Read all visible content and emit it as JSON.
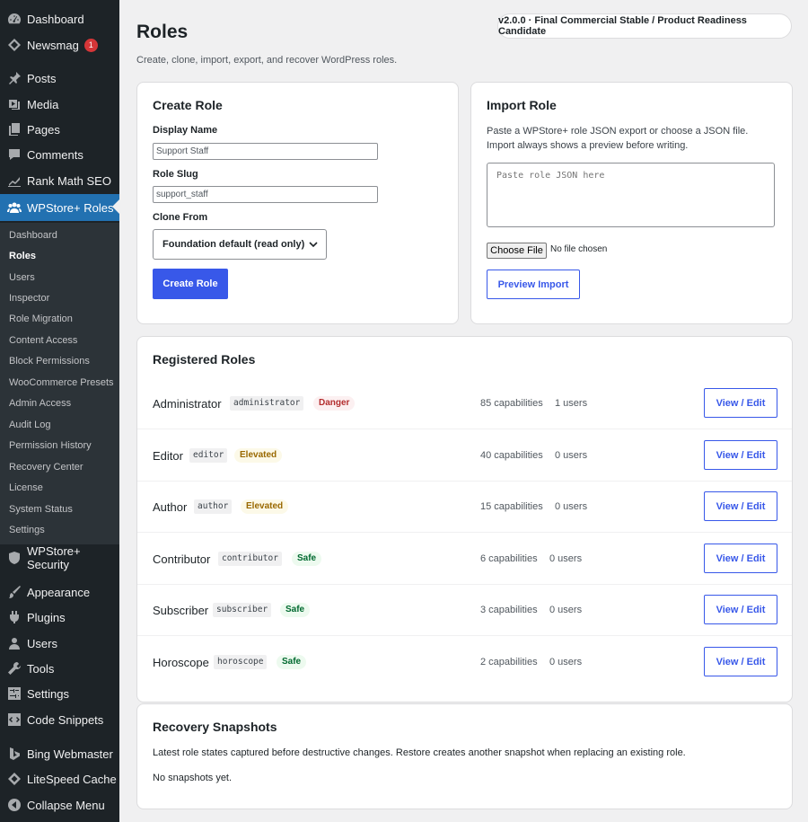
{
  "sidebar": {
    "top_items": [
      {
        "label": "Dashboard",
        "icon": "dashboard-icon"
      },
      {
        "label": "Newsmag",
        "icon": "newsmag-icon",
        "badge": "1"
      }
    ],
    "content_items": [
      {
        "label": "Posts",
        "icon": "pin-icon"
      },
      {
        "label": "Media",
        "icon": "media-icon"
      },
      {
        "label": "Pages",
        "icon": "pages-icon"
      },
      {
        "label": "Comments",
        "icon": "comments-icon"
      },
      {
        "label": "Rank Math SEO",
        "icon": "chart-icon"
      },
      {
        "label": "WPStore+ Roles",
        "icon": "users-group-icon"
      }
    ],
    "submenu": [
      "Dashboard",
      "Roles",
      "Users",
      "Inspector",
      "Role Migration",
      "Content Access",
      "Block Permissions",
      "WooCommerce Presets",
      "Admin Access",
      "Audit Log",
      "Permission History",
      "Recovery Center",
      "License",
      "System Status",
      "Settings"
    ],
    "submenu_current": "Roles",
    "security_item": {
      "label": "WPStore+ Security",
      "icon": "shield-icon"
    },
    "bottom_items": [
      {
        "label": "Appearance",
        "icon": "brush-icon"
      },
      {
        "label": "Plugins",
        "icon": "plugin-icon"
      },
      {
        "label": "Users",
        "icon": "user-icon"
      },
      {
        "label": "Tools",
        "icon": "wrench-icon"
      },
      {
        "label": "Settings",
        "icon": "settings-icon"
      },
      {
        "label": "Code Snippets",
        "icon": "code-icon"
      }
    ],
    "extra_items": [
      {
        "label": "Bing Webmaster",
        "icon": "bing-icon"
      },
      {
        "label": "LiteSpeed Cache",
        "icon": "diamond-icon"
      },
      {
        "label": "Collapse Menu",
        "icon": "collapse-icon"
      }
    ]
  },
  "header": {
    "title": "Roles",
    "subtitle": "Create, clone, import, export, and recover WordPress roles.",
    "version": "v2.0.0 · Final Commercial Stable / Product Readiness Candidate"
  },
  "create_role": {
    "title": "Create Role",
    "display_name_label": "Display Name",
    "display_name_value": "Support Staff",
    "slug_label": "Role Slug",
    "slug_value": "support_staff",
    "clone_label": "Clone From",
    "clone_value": "Foundation default (read only)",
    "button": "Create Role"
  },
  "import_role": {
    "title": "Import Role",
    "description": "Paste a WPStore+ role JSON export or choose a JSON file. Import always shows a preview before writing.",
    "placeholder": "Paste role JSON here",
    "choose_file": "Choose File",
    "file_status": "No file chosen",
    "button": "Preview Import"
  },
  "registered_roles": {
    "title": "Registered Roles",
    "rows": [
      {
        "name": "Administrator",
        "slug": "administrator",
        "risk": "Danger",
        "risk_type": "danger",
        "capabilities": "85 capabilities",
        "users": "1 users",
        "action": "View / Edit"
      },
      {
        "name": "Editor",
        "slug": "editor",
        "risk": "Elevated",
        "risk_type": "elevated",
        "capabilities": "40 capabilities",
        "users": "0 users",
        "action": "View / Edit"
      },
      {
        "name": "Author",
        "slug": "author",
        "risk": "Elevated",
        "risk_type": "elevated",
        "capabilities": "15 capabilities",
        "users": "0 users",
        "action": "View / Edit"
      },
      {
        "name": "Contributor",
        "slug": "contributor",
        "risk": "Safe",
        "risk_type": "safe",
        "capabilities": "6 capabilities",
        "users": "0 users",
        "action": "View / Edit"
      },
      {
        "name": "Subscriber",
        "slug": "subscriber",
        "risk": "Safe",
        "risk_type": "safe",
        "capabilities": "3 capabilities",
        "users": "0 users",
        "action": "View / Edit"
      },
      {
        "name": "Horoscope",
        "slug": "horoscope",
        "risk": "Safe",
        "risk_type": "safe",
        "capabilities": "2 capabilities",
        "users": "0 users",
        "action": "View / Edit"
      }
    ]
  },
  "recovery": {
    "title": "Recovery Snapshots",
    "description": "Latest role states captured before destructive changes. Restore creates another snapshot when replacing an existing role.",
    "empty": "No snapshots yet."
  },
  "colors": {
    "sidebar_bg": "#1d2327",
    "submenu_bg": "#2c3338",
    "active_item": "#2271b1",
    "primary_button": "#3858e9",
    "danger": "#b32d2e",
    "elevated": "#996800",
    "safe": "#00692f"
  }
}
